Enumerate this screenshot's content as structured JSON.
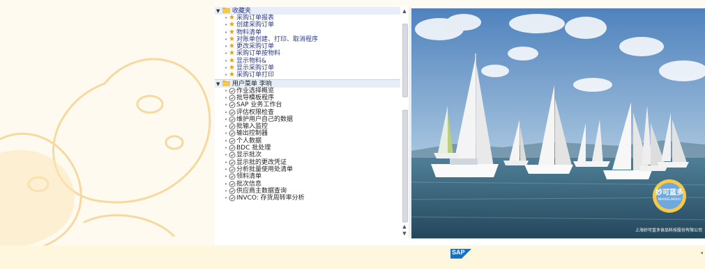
{
  "favorites": {
    "folder_label": "收藏夹",
    "items": [
      {
        "label": "采购订单报表"
      },
      {
        "label": "创建采购订单"
      },
      {
        "label": "物料清单"
      },
      {
        "label": "对账单创建、打印、取消程序"
      },
      {
        "label": "更改采购订单"
      },
      {
        "label": "采购订单按物料"
      },
      {
        "label": "显示物料&"
      },
      {
        "label": "显示采购订单"
      },
      {
        "label": "采购订单打印"
      }
    ]
  },
  "user_menu": {
    "folder_label": "用户菜单 李响",
    "items": [
      {
        "label": "作业选择概览"
      },
      {
        "label": "批导模板程序"
      },
      {
        "label": "SAP 业务工作台"
      },
      {
        "label": "评估权限检查"
      },
      {
        "label": "维护用户自己的数据"
      },
      {
        "label": "批输入监控"
      },
      {
        "label": "输出控制器"
      },
      {
        "label": "个人数据"
      },
      {
        "label": "BDC 批处理"
      },
      {
        "label": "显示批次"
      },
      {
        "label": "显示批的更改凭证"
      },
      {
        "label": "分析批量使用处清单"
      },
      {
        "label": "领料清单"
      },
      {
        "label": "批次信息"
      },
      {
        "label": "供应商主数据查询"
      },
      {
        "label": "INVCO: 存货周转率分析"
      }
    ]
  },
  "photo": {
    "brand_text": "妙可蓝多",
    "brand_sub": "MIAOKELANDUO",
    "caption": "上海妙可蓝多食品科技股份有限公司"
  },
  "footer": {
    "logo_text": "SAP"
  },
  "colors": {
    "favorite_star": "#e8a013",
    "folder": "#f0b429",
    "sea": "#3f6f8a",
    "sky": "#5d8fc4"
  }
}
